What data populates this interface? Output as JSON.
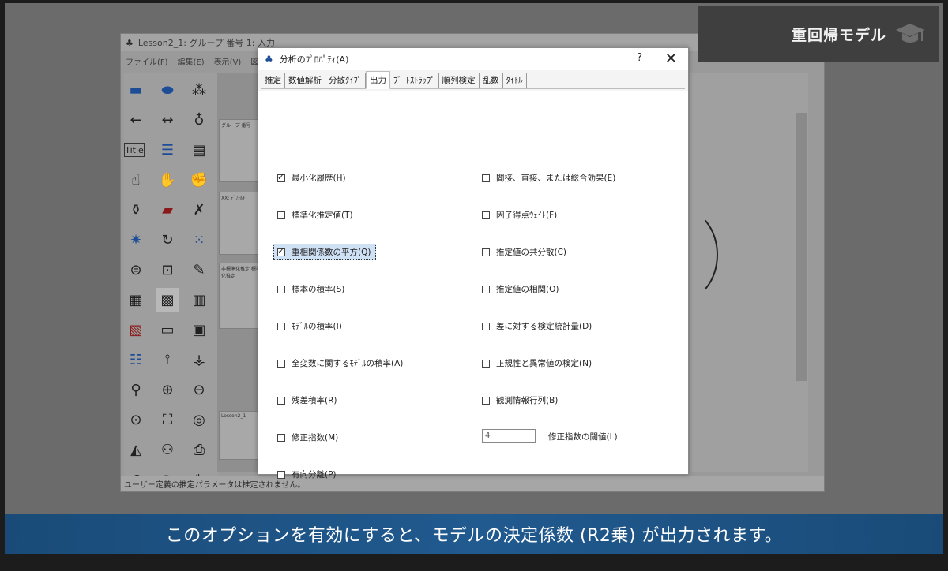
{
  "overlay": {
    "title": "重回帰モデル",
    "icon": "graduation-cap-icon"
  },
  "main_window": {
    "title": "Lesson2_1: グループ 番号 1: 入力",
    "menus": [
      "ファイル(F)",
      "編集(E)",
      "表示(V)",
      "図"
    ],
    "panel_labels": [
      "グループ 番号",
      "XX: ﾃﾞﾌｫﾙﾄ",
      "非標準化推定 標準化推定",
      "Lesson2_1"
    ],
    "status": "ユーザー定義の推定パラメータは推定されません。"
  },
  "dialog": {
    "title": "分析のﾌﾟﾛﾊﾟﾃｨ(A)",
    "help_label": "?",
    "close_label": "✕",
    "tabs": [
      "推定",
      "数値解析",
      "分散ﾀｲﾌﾟ",
      "出力",
      "ﾌﾞｰﾄｽﾄﾗｯﾌﾟ",
      "順列検定",
      "乱数",
      "ﾀｲﾄﾙ"
    ],
    "active_tab": "出力",
    "left_options": [
      {
        "label": "最小化履歴(H)",
        "checked": true
      },
      {
        "label": "標準化推定値(T)",
        "checked": false
      },
      {
        "label": "重相関係数の平方(Q)",
        "checked": true
      },
      {
        "label": "標本の積率(S)",
        "checked": false
      },
      {
        "label": "ﾓﾃﾞﾙの積率(I)",
        "checked": false
      },
      {
        "label": "全変数に関するﾓﾃﾞﾙの積率(A)",
        "checked": false
      },
      {
        "label": "残差積率(R)",
        "checked": false
      },
      {
        "label": "修正指数(M)",
        "checked": false
      },
      {
        "label": "有向分離(P)",
        "checked": false
      }
    ],
    "right_options": [
      {
        "label": "間接、直接、または総合効果(E)",
        "checked": false
      },
      {
        "label": "因子得点ｳｪｲﾄ(F)",
        "checked": false
      },
      {
        "label": "推定値の共分散(C)",
        "checked": false
      },
      {
        "label": "推定値の相関(O)",
        "checked": false
      },
      {
        "label": "差に対する検定統計量(D)",
        "checked": false
      },
      {
        "label": "正規性と異常値の検定(N)",
        "checked": false
      },
      {
        "label": "観測情報行列(B)",
        "checked": false
      }
    ],
    "threshold_value": "4",
    "threshold_label": "修正指数の閾値(L)"
  },
  "subtitle": "このオプションを有効にすると、モデルの決定係数 (R2乗) が出力されます。"
}
